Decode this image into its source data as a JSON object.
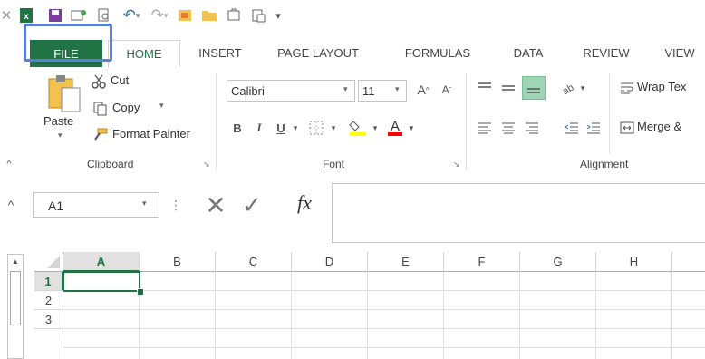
{
  "quick_access": {
    "icons": [
      "excel-icon",
      "save-icon",
      "touch-mode-icon",
      "print-preview-icon",
      "undo-icon",
      "redo-icon",
      "insert-icon",
      "open-icon",
      "attach-icon",
      "clipboard-icon",
      "customize-icon"
    ]
  },
  "tabs": [
    {
      "label": "FILE"
    },
    {
      "label": "HOME"
    },
    {
      "label": "INSERT"
    },
    {
      "label": "PAGE LAYOUT"
    },
    {
      "label": "FORMULAS"
    },
    {
      "label": "DATA"
    },
    {
      "label": "REVIEW"
    },
    {
      "label": "VIEW"
    }
  ],
  "ribbon": {
    "clipboard": {
      "paste": "Paste",
      "cut": "Cut",
      "copy": "Copy",
      "format_painter": "Format Painter",
      "label": "Clipboard"
    },
    "font": {
      "name": "Calibri",
      "size": "11",
      "bold": "B",
      "italic": "I",
      "underline": "U",
      "font_color_letter": "A",
      "label": "Font"
    },
    "alignment": {
      "wrap_text": "Wrap Tex",
      "merge": "Merge &",
      "label": "Alignment"
    }
  },
  "formula_bar": {
    "name_box": "A1",
    "fx": "fx",
    "value": ""
  },
  "grid": {
    "columns": [
      "A",
      "B",
      "C",
      "D",
      "E",
      "F",
      "G",
      "H"
    ],
    "rows": [
      "1",
      "2",
      "3"
    ],
    "active_cell": "A1"
  },
  "colors": {
    "excel_green": "#217346",
    "highlight_blue": "#5b7fd6",
    "fill_yellow": "#ffff00",
    "font_red": "#ff0000"
  }
}
